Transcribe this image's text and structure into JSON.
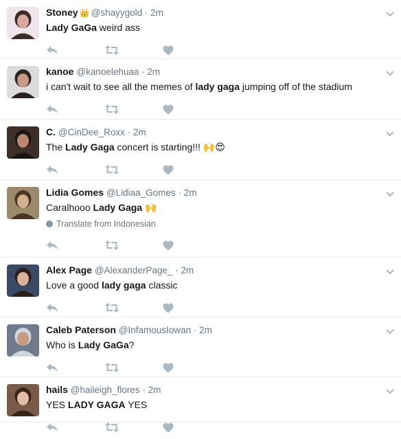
{
  "colors": {
    "text": "#14171a",
    "muted": "#657786",
    "icon": "#aab8c2",
    "border": "#e6ecf0"
  },
  "tweets": [
    {
      "fullname": "Stoney",
      "badge": "crown-emoji",
      "handle": "@shayygold",
      "time": "2m",
      "text_parts": [
        {
          "t": "Lady GaGa",
          "bold": true
        },
        {
          "t": " weird ass",
          "bold": false
        }
      ]
    },
    {
      "fullname": "kanoe",
      "handle": "@kanoelehuaa",
      "time": "2m",
      "text_parts": [
        {
          "t": "i can't wait to see all the memes of ",
          "bold": false
        },
        {
          "t": "lady gaga",
          "bold": true
        },
        {
          "t": " jumping off of the stadium",
          "bold": false
        }
      ]
    },
    {
      "fullname": "C.",
      "handle": "@CinDee_Roxx",
      "time": "2m",
      "text_parts": [
        {
          "t": "The ",
          "bold": false
        },
        {
          "t": "Lady Gaga",
          "bold": true
        },
        {
          "t": " concert is starting!!! ",
          "bold": false
        },
        {
          "t": "🙌😍",
          "bold": false
        }
      ]
    },
    {
      "fullname": "Lidia Gomes",
      "handle": "@Lidiaa_Gomes",
      "time": "2m",
      "text_parts": [
        {
          "t": "Caralhooo ",
          "bold": false
        },
        {
          "t": "Lady Gaga",
          "bold": true
        },
        {
          "t": " 🙌",
          "bold": false
        }
      ],
      "translate": "Translate from Indonesian"
    },
    {
      "fullname": "Alex Page",
      "handle": "@AlexanderPage_",
      "time": "2m",
      "text_parts": [
        {
          "t": "Love a good ",
          "bold": false
        },
        {
          "t": "lady gaga",
          "bold": true
        },
        {
          "t": " classic",
          "bold": false
        }
      ]
    },
    {
      "fullname": "Caleb Paterson",
      "handle": "@InfamousIowan",
      "time": "2m",
      "text_parts": [
        {
          "t": "Who is ",
          "bold": false
        },
        {
          "t": "Lady GaGa",
          "bold": true
        },
        {
          "t": "?",
          "bold": false
        }
      ]
    },
    {
      "fullname": "hails",
      "handle": "@haileigh_flores",
      "time": "2m",
      "text_parts": [
        {
          "t": "YES ",
          "bold": false
        },
        {
          "t": "LADY GAGA",
          "bold": true
        },
        {
          "t": " YES",
          "bold": false
        }
      ]
    }
  ],
  "icons": {
    "reply": "reply-icon",
    "retweet": "retweet-icon",
    "like": "heart-icon",
    "menu": "chevron-down-icon",
    "translate": "globe-icon"
  }
}
